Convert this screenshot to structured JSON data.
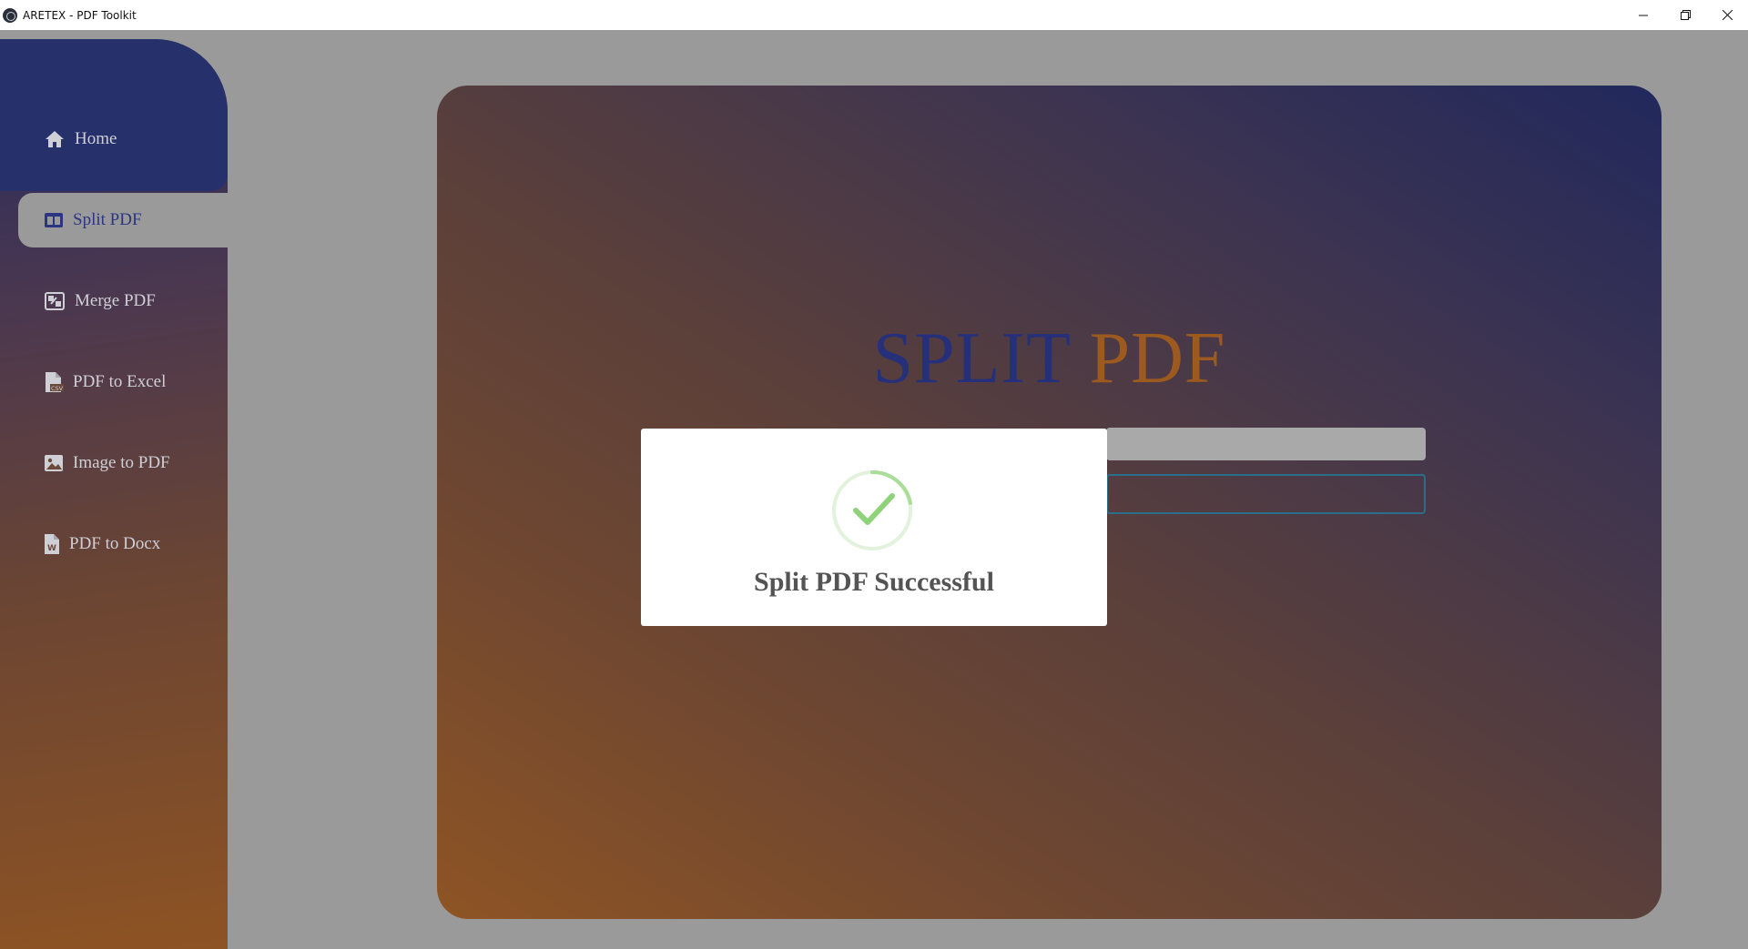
{
  "window": {
    "title": "ARETEX - PDF Toolkit",
    "controls": [
      "minimize",
      "restore",
      "close"
    ]
  },
  "sidebar": {
    "items": [
      {
        "label": "Home",
        "icon": "home-icon",
        "active": false
      },
      {
        "label": "Split PDF",
        "icon": "columns-icon",
        "active": true
      },
      {
        "label": "Merge PDF",
        "icon": "merge-icon",
        "active": false
      },
      {
        "label": "PDF to Excel",
        "icon": "csv-file-icon",
        "active": false
      },
      {
        "label": "Image to PDF",
        "icon": "image-icon",
        "active": false
      },
      {
        "label": "PDF to Docx",
        "icon": "word-file-icon",
        "active": false
      }
    ]
  },
  "main": {
    "title_part1": "SPLIT",
    "title_part2": "PDF"
  },
  "modal": {
    "message": "Split PDF Successful",
    "icon": "success-check-icon"
  },
  "colors": {
    "accent_blue": "#26307a",
    "accent_orange": "#9d5a1f",
    "success_green": "#8ed37a",
    "backdrop": "#9a9a9a"
  }
}
